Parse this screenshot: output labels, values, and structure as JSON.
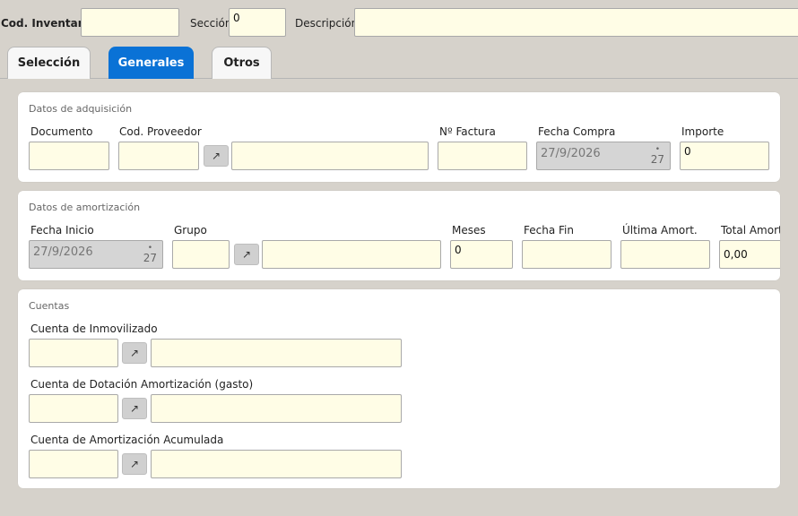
{
  "header": {
    "cod_inventario_label": "Cod. Inventario",
    "cod_inventario_value": "",
    "seccion_label": "Sección",
    "seccion_value": "0",
    "descripcion_label": "Descripción",
    "descripcion_value": ""
  },
  "tabs": [
    {
      "label": "Selección",
      "active": false
    },
    {
      "label": "Generales",
      "active": true
    },
    {
      "label": "Otros",
      "active": false
    }
  ],
  "lookup_icon": "↗",
  "adquisicion": {
    "title": "Datos de adquisición",
    "documento_label": "Documento",
    "documento_value": "",
    "proveedor_label": "Cod. Proveedor",
    "proveedor_code": "",
    "proveedor_name": "",
    "factura_label": "Nº Factura",
    "factura_value": "",
    "fecha_compra_label": "Fecha Compra",
    "fecha_compra_value": "27/9/2026",
    "importe_label": "Importe",
    "importe_value": "0"
  },
  "amortizacion": {
    "title": "Datos de amortización",
    "fecha_inicio_label": "Fecha Inicio",
    "fecha_inicio_value": "27/9/2026",
    "grupo_label": "Grupo",
    "grupo_code": "",
    "grupo_name": "",
    "meses_label": "Meses",
    "meses_value": "0",
    "fecha_fin_label": "Fecha Fin",
    "fecha_fin_value": "",
    "ultima_label": "Última Amort.",
    "ultima_value": "",
    "total_label": "Total Amortiza",
    "total_value": "0,00"
  },
  "calendar": {
    "dot": "•",
    "day": "27"
  },
  "cuentas": {
    "title": "Cuentas",
    "inmovilizado_label": "Cuenta de Inmovilizado",
    "inmovilizado_code": "",
    "inmovilizado_name": "",
    "dotacion_label": "Cuenta de Dotación Amortización (gasto)",
    "dotacion_code": "",
    "dotacion_name": "",
    "acumulada_label": "Cuenta de Amortización Acumulada",
    "acumulada_code": "",
    "acumulada_name": ""
  }
}
